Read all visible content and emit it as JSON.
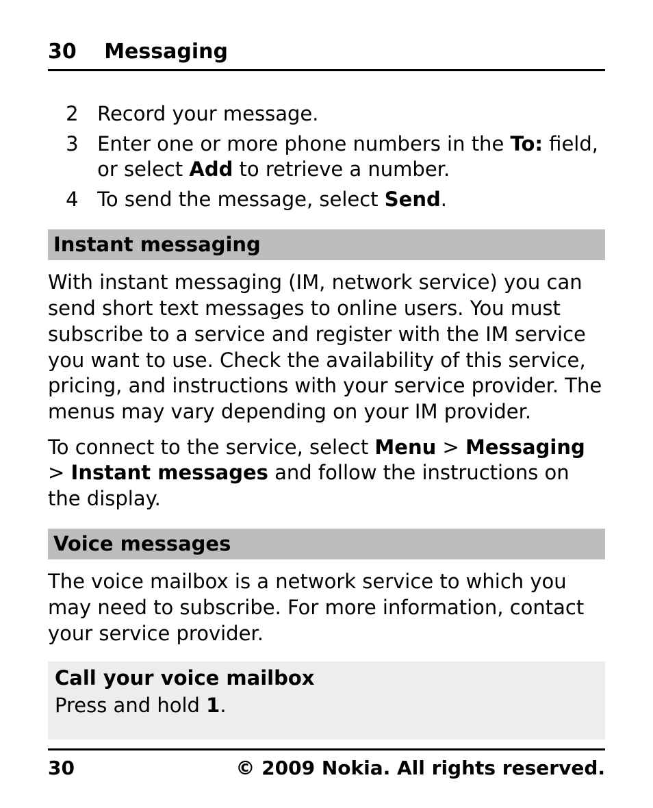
{
  "header": {
    "page_number": "30",
    "section": "Messaging"
  },
  "steps": {
    "s2": {
      "num": "2",
      "text": "Record your message."
    },
    "s3": {
      "num": "3",
      "t1": "Enter one or more phone numbers in the ",
      "b1": "To:",
      "t2": " field, or select ",
      "b2": "Add",
      "t3": " to retrieve a number."
    },
    "s4": {
      "num": "4",
      "t1": "To send the message, select ",
      "b1": "Send",
      "t2": "."
    }
  },
  "im": {
    "title": "Instant messaging",
    "para1": "With instant messaging (IM, network service) you can send short text messages to online users. You must subscribe to a service and register with the IM service you want to use. Check the availability of this service, pricing, and instructions with your service provider. The menus may vary depending on your IM provider.",
    "p2_t1": "To connect to the service, select ",
    "p2_b1": "Menu",
    "p2_t2": " > ",
    "p2_b2": "Messaging",
    "p2_t3": " > ",
    "p2_b3": "Instant messages",
    "p2_t4": " and follow the instructions on the display."
  },
  "vm": {
    "title": "Voice messages",
    "para": "The voice mailbox is a network service to which you may need to subscribe. For more information, contact your service provider."
  },
  "call_box": {
    "title": "Call your voice mailbox",
    "t1": "Press and hold ",
    "b1": "1",
    "t2": "."
  },
  "footer": {
    "page": "30",
    "copyright": "© 2009 Nokia. All rights reserved."
  }
}
